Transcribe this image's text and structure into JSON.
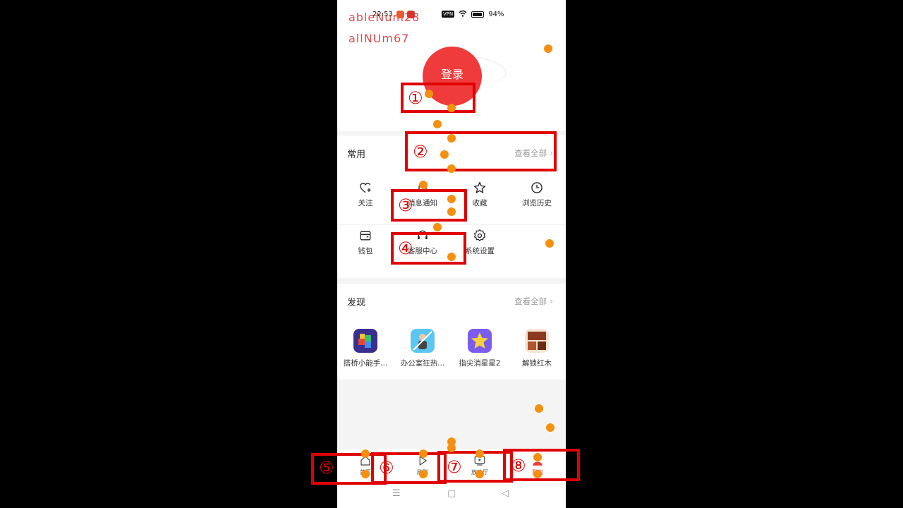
{
  "status_bar": {
    "time": "22:53",
    "vpn": "VPN",
    "battery": "94%"
  },
  "overlay": {
    "line1": "ableNum28",
    "line2": "allNUm67"
  },
  "login": {
    "label": "登录"
  },
  "common": {
    "title": "常用",
    "more": "查看全部",
    "items": [
      {
        "label": "关注",
        "icon": "heart-plus-icon"
      },
      {
        "label": "消息通知",
        "icon": "bell-icon"
      },
      {
        "label": "收藏",
        "icon": "star-icon"
      },
      {
        "label": "浏览历史",
        "icon": "clock-icon"
      },
      {
        "label": "钱包",
        "icon": "wallet-icon"
      },
      {
        "label": "客服中心",
        "icon": "headset-icon"
      },
      {
        "label": "系统设置",
        "icon": "gear-icon"
      }
    ]
  },
  "discover": {
    "title": "发现",
    "more": "查看全部",
    "apps": [
      {
        "label": "搭桥小能手...",
        "icon": "bridge-game-icon"
      },
      {
        "label": "办公室狂热...",
        "icon": "office-game-icon"
      },
      {
        "label": "指尖消星星2",
        "icon": "star-game-icon"
      },
      {
        "label": "解锁红木",
        "icon": "wood-game-icon"
      }
    ]
  },
  "bottom_nav": {
    "items": [
      {
        "label": "首页",
        "icon": "home-icon"
      },
      {
        "label": "刷剧",
        "icon": "play-icon"
      },
      {
        "label": "放映厅",
        "icon": "tv-icon"
      },
      {
        "label": "我的",
        "icon": "user-icon"
      }
    ]
  },
  "annotations": [
    "①",
    "②",
    "③",
    "④",
    "⑤",
    "⑥",
    "⑦",
    "⑧"
  ],
  "colors": {
    "accent": "#ef3b3b",
    "annotation": "#e00000",
    "dot": "#f5900f"
  }
}
